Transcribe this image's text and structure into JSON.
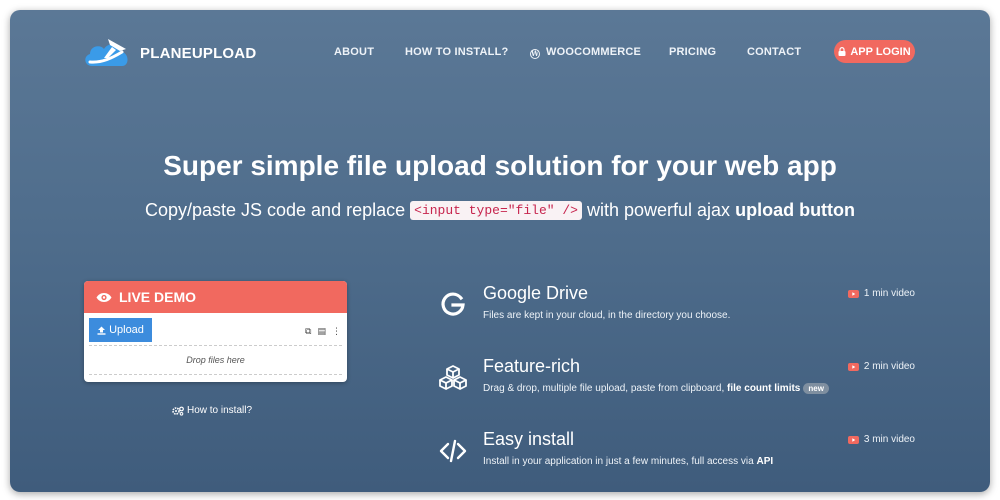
{
  "brand": {
    "name": "PLANEUPLOAD",
    "logo_icon": "cloud-plane-logo"
  },
  "nav": {
    "items": [
      {
        "label": "ABOUT"
      },
      {
        "label": "HOW TO INSTALL?"
      },
      {
        "label": "WOOCOMMERCE",
        "icon": "wordpress-icon"
      },
      {
        "label": "PRICING"
      },
      {
        "label": "CONTACT"
      }
    ],
    "login_label": "APP LOGIN",
    "login_icon": "lock-icon"
  },
  "hero": {
    "headline": "Super simple file upload solution for your web app",
    "sub_before": "Copy/paste JS code and replace",
    "sub_code": "<input type=\"file\" />",
    "sub_middle": "with powerful ajax",
    "sub_bold": "upload button"
  },
  "demo": {
    "title": "LIVE DEMO",
    "title_icon": "eye-icon",
    "upload_label": "Upload",
    "dropzone_text": "Drop files here",
    "howto_label": "How to install?",
    "howto_icon": "gears-icon"
  },
  "features": [
    {
      "icon": "google-g-icon",
      "title": "Google Drive",
      "desc": "Files are kept in your cloud, in the directory you choose.",
      "video": "1 min video"
    },
    {
      "icon": "cubes-icon",
      "title": "Feature-rich",
      "desc": "Drag & drop, multiple file upload, paste from clipboard,",
      "desc_bold": "file count limits",
      "badge": "new",
      "video": "2 min video"
    },
    {
      "icon": "code-icon",
      "title": "Easy install",
      "desc": "Install in your application in just a few minutes, full access via",
      "desc_bold": "API",
      "video": "3 min video"
    }
  ],
  "colors": {
    "accent": "#f1695f",
    "upload_button": "#3c8cdd",
    "background": "#4f6d8c"
  }
}
